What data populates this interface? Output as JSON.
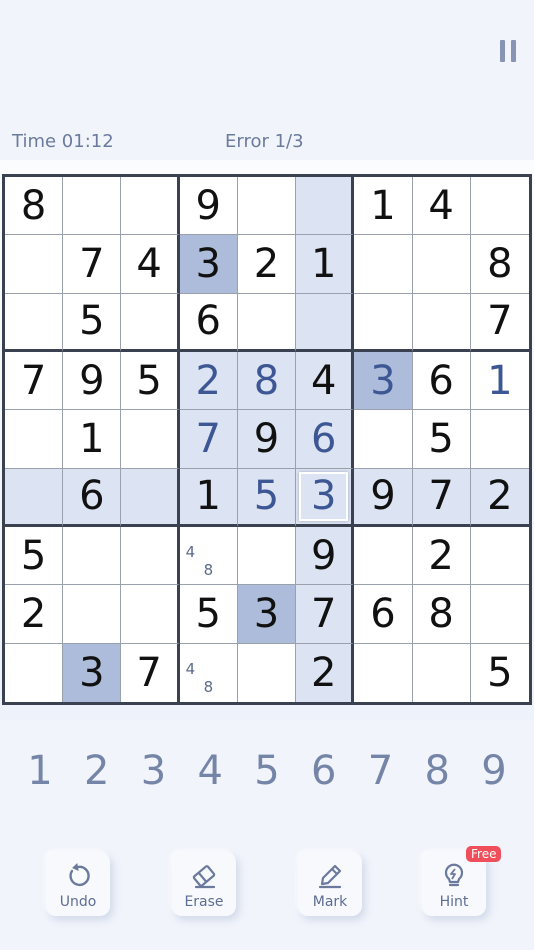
{
  "status": {
    "time_label": "Time",
    "time_value": "01:12",
    "error_label": "Error",
    "error_value": "1/3"
  },
  "board": {
    "rows": [
      [
        "8",
        "",
        "",
        "9",
        "",
        "",
        "1",
        "4",
        ""
      ],
      [
        "",
        "7",
        "4",
        "3",
        "2",
        "1",
        "",
        "",
        "8"
      ],
      [
        "",
        "5",
        "",
        "6",
        "",
        "",
        "",
        "",
        "7"
      ],
      [
        "7",
        "9",
        "5",
        "2",
        "8",
        "4",
        "3",
        "6",
        "1"
      ],
      [
        "",
        "1",
        "",
        "7",
        "9",
        "6",
        "",
        "5",
        ""
      ],
      [
        "",
        "6",
        "",
        "1",
        "5",
        "3",
        "9",
        "7",
        "2"
      ],
      [
        "5",
        "",
        "",
        "",
        "",
        "9",
        "",
        "2",
        ""
      ],
      [
        "2",
        "",
        "",
        "5",
        "3",
        "7",
        "6",
        "8",
        ""
      ],
      [
        "",
        "3",
        "7",
        "",
        "",
        "2",
        "",
        "",
        "5"
      ]
    ],
    "user_entered": [
      [
        3,
        3
      ],
      [
        3,
        4
      ],
      [
        3,
        6
      ],
      [
        3,
        8
      ],
      [
        4,
        3
      ],
      [
        4,
        5
      ],
      [
        5,
        4
      ],
      [
        5,
        5
      ]
    ],
    "highlighted": [
      [
        0,
        5
      ],
      [
        1,
        5
      ],
      [
        2,
        5
      ],
      [
        3,
        3
      ],
      [
        3,
        4
      ],
      [
        3,
        5
      ],
      [
        4,
        3
      ],
      [
        4,
        4
      ],
      [
        4,
        5
      ],
      [
        5,
        0
      ],
      [
        5,
        1
      ],
      [
        5,
        2
      ],
      [
        5,
        3
      ],
      [
        5,
        4
      ],
      [
        5,
        6
      ],
      [
        5,
        7
      ],
      [
        5,
        8
      ],
      [
        6,
        5
      ],
      [
        7,
        5
      ],
      [
        8,
        5
      ]
    ],
    "same_number": [
      [
        1,
        3
      ],
      [
        3,
        6
      ],
      [
        7,
        4
      ],
      [
        8,
        1
      ]
    ],
    "selected": [
      5,
      5
    ],
    "notes": [
      {
        "cell": [
          6,
          3
        ],
        "values": [
          "4",
          "8"
        ]
      },
      {
        "cell": [
          8,
          3
        ],
        "values": [
          "4",
          "8"
        ]
      }
    ]
  },
  "numpad": [
    "1",
    "2",
    "3",
    "4",
    "5",
    "6",
    "7",
    "8",
    "9"
  ],
  "tools": {
    "undo": "Undo",
    "erase": "Erase",
    "mark": "Mark",
    "hint": "Hint",
    "hint_badge": "Free"
  },
  "icons": {
    "pause": "pause-icon",
    "undo": "undo-icon",
    "erase": "eraser-icon",
    "mark": "pencil-icon",
    "hint": "lightbulb-icon"
  },
  "colors": {
    "background": "#f1f4fb",
    "highlight": "#dce3f2",
    "same_number": "#aebcdb",
    "user_digit": "#3d5795",
    "numpad_digit": "#7585a8",
    "badge": "#ef4e5a"
  }
}
